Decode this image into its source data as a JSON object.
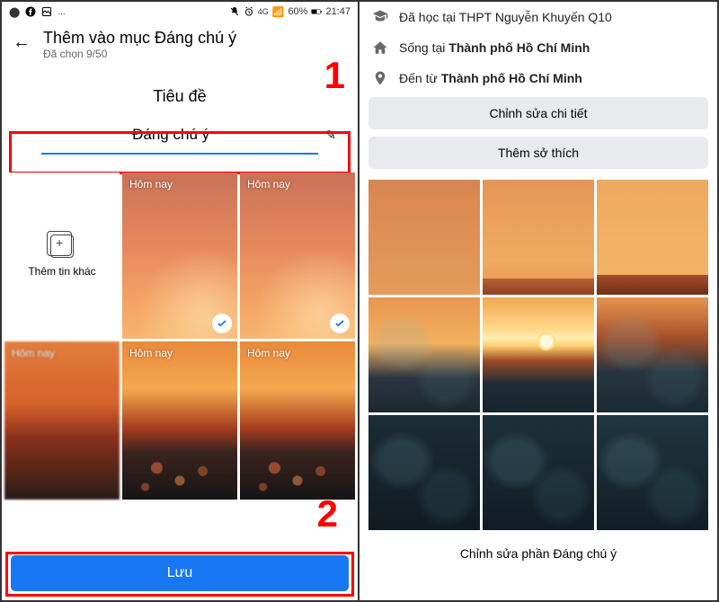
{
  "status": {
    "battery_pct": "60%",
    "time": "21:47",
    "net": "4G"
  },
  "left": {
    "header_title": "Thêm vào mục Đáng chú ý",
    "header_sub": "Đã chọn 9/50",
    "section_title": "Tiêu đề",
    "title_value": "Đáng chú ý",
    "add_more_label": "Thêm tin khác",
    "stories": [
      {
        "label": "Hôm nay",
        "selected": true
      },
      {
        "label": "Hôm nay",
        "selected": true
      },
      {
        "label": "Hôm nay",
        "selected": false
      },
      {
        "label": "Hôm nay",
        "selected": false
      },
      {
        "label": "Hôm nay",
        "selected": false
      }
    ],
    "save_label": "Lưu",
    "annotation_1": "1",
    "annotation_2": "2"
  },
  "right": {
    "info": {
      "education_prefix": "Đã học tại ",
      "education_value": "THPT Nguyễn Khuyến Q10",
      "lives_prefix": "Sống tại ",
      "lives_value": "Thành phố Hồ Chí Minh",
      "from_prefix": "Đến từ ",
      "from_value": "Thành phố Hồ Chí Minh"
    },
    "btn_edit_details": "Chỉnh sửa chi tiết",
    "btn_add_hobbies": "Thêm sở thích",
    "btn_edit_featured": "Chỉnh sửa phần Đáng chú ý"
  }
}
